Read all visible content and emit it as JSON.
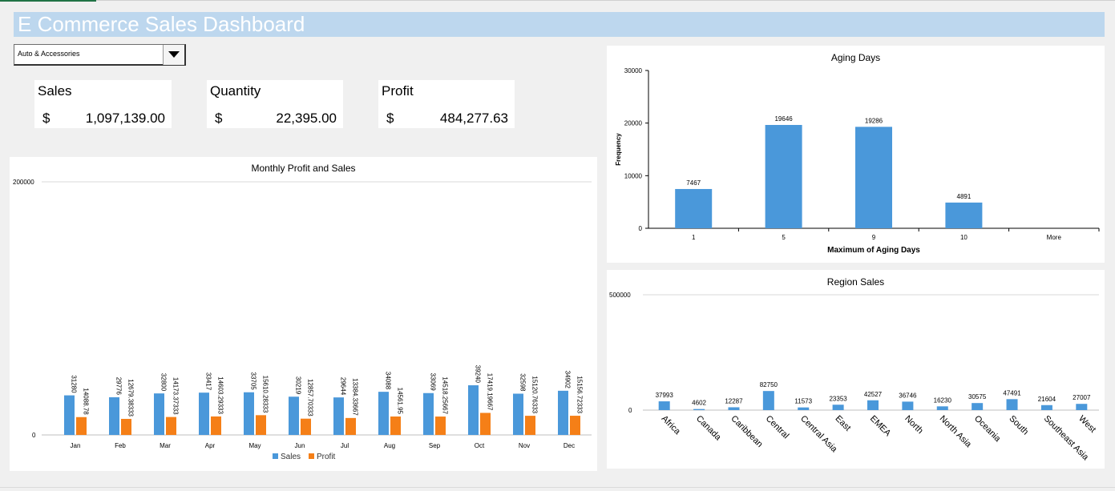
{
  "dashboard": {
    "title": "E Commerce Sales Dashboard",
    "filter": {
      "selected": "Auto & Accessories"
    },
    "colors": {
      "sales": "#4a98da",
      "profit": "#f57f17",
      "title_bg": "#bdd7ee"
    }
  },
  "kpis": {
    "sales": {
      "label": "Sales",
      "currency": "$",
      "value": "1,097,139.00"
    },
    "quantity": {
      "label": "Quantity",
      "currency": "$",
      "value": "22,395.00"
    },
    "profit": {
      "label": "Profit",
      "currency": "$",
      "value": "484,277.63"
    }
  },
  "chart_data": [
    {
      "type": "bar",
      "title": "Monthly Profit and Sales",
      "categories": [
        "Jan",
        "Feb",
        "Mar",
        "Apr",
        "May",
        "Jun",
        "Jul",
        "Aug",
        "Sep",
        "Oct",
        "Nov",
        "Dec"
      ],
      "series": [
        {
          "name": "Sales",
          "values": [
            31280,
            29776,
            32800,
            33417,
            33705,
            30219,
            29644,
            34088,
            33069,
            39240,
            32598,
            34902
          ],
          "labels": [
            "31280",
            "29776",
            "32800",
            "33417",
            "33705",
            "30219",
            "29644",
            "34088",
            "33069",
            "39240",
            "32598",
            "34902"
          ]
        },
        {
          "name": "Profit",
          "values": [
            14088.78,
            12679.38333,
            14173.37333,
            14603.29333,
            15610.28333,
            12857.70333,
            13384.33667,
            14561.95,
            14518.25667,
            17419.19667,
            15120.76333,
            15156.72333
          ],
          "labels": [
            "14088.78",
            "12679.38333",
            "14173.37333",
            "14603.29333",
            "15610.28333",
            "12857.70333",
            "13384.33667",
            "14561.95",
            "14518.25667",
            "17419.19667",
            "15120.76333",
            "15156.72333"
          ]
        }
      ],
      "ylim": [
        0,
        200000
      ],
      "y_ticks": [
        "0",
        "200000"
      ],
      "legend": "bottom"
    },
    {
      "type": "bar",
      "title": "Aging Days",
      "categories": [
        "1",
        "5",
        "9",
        "10",
        "More"
      ],
      "values": [
        7467,
        19646,
        19286,
        4891,
        0
      ],
      "labels": [
        "7467",
        "19646",
        "19286",
        "4891",
        ""
      ],
      "xlabel": "Maximum of  Aging Days",
      "ylabel": "Frequency",
      "ylim": [
        0,
        30000
      ],
      "y_ticks": [
        "0",
        "10000",
        "20000",
        "30000"
      ]
    },
    {
      "type": "bar",
      "title": "Region Sales",
      "categories": [
        "Africa",
        "Canada",
        "Caribbean",
        "Central",
        "Central Asia",
        "East",
        "EMEA",
        "North",
        "North Asia",
        "Oceania",
        "South",
        "Southeast Asia",
        "West"
      ],
      "values": [
        37993,
        4602,
        12287,
        82750,
        11573,
        23353,
        42527,
        36746,
        16230,
        30575,
        47491,
        21604,
        27007
      ],
      "labels": [
        "37993",
        "4602",
        "12287",
        "82750",
        "11573",
        "23353",
        "42527",
        "36746",
        "16230",
        "30575",
        "47491",
        "21604",
        "27007"
      ],
      "ylim": [
        0,
        500000
      ],
      "y_ticks": [
        "0",
        "500000"
      ]
    }
  ]
}
